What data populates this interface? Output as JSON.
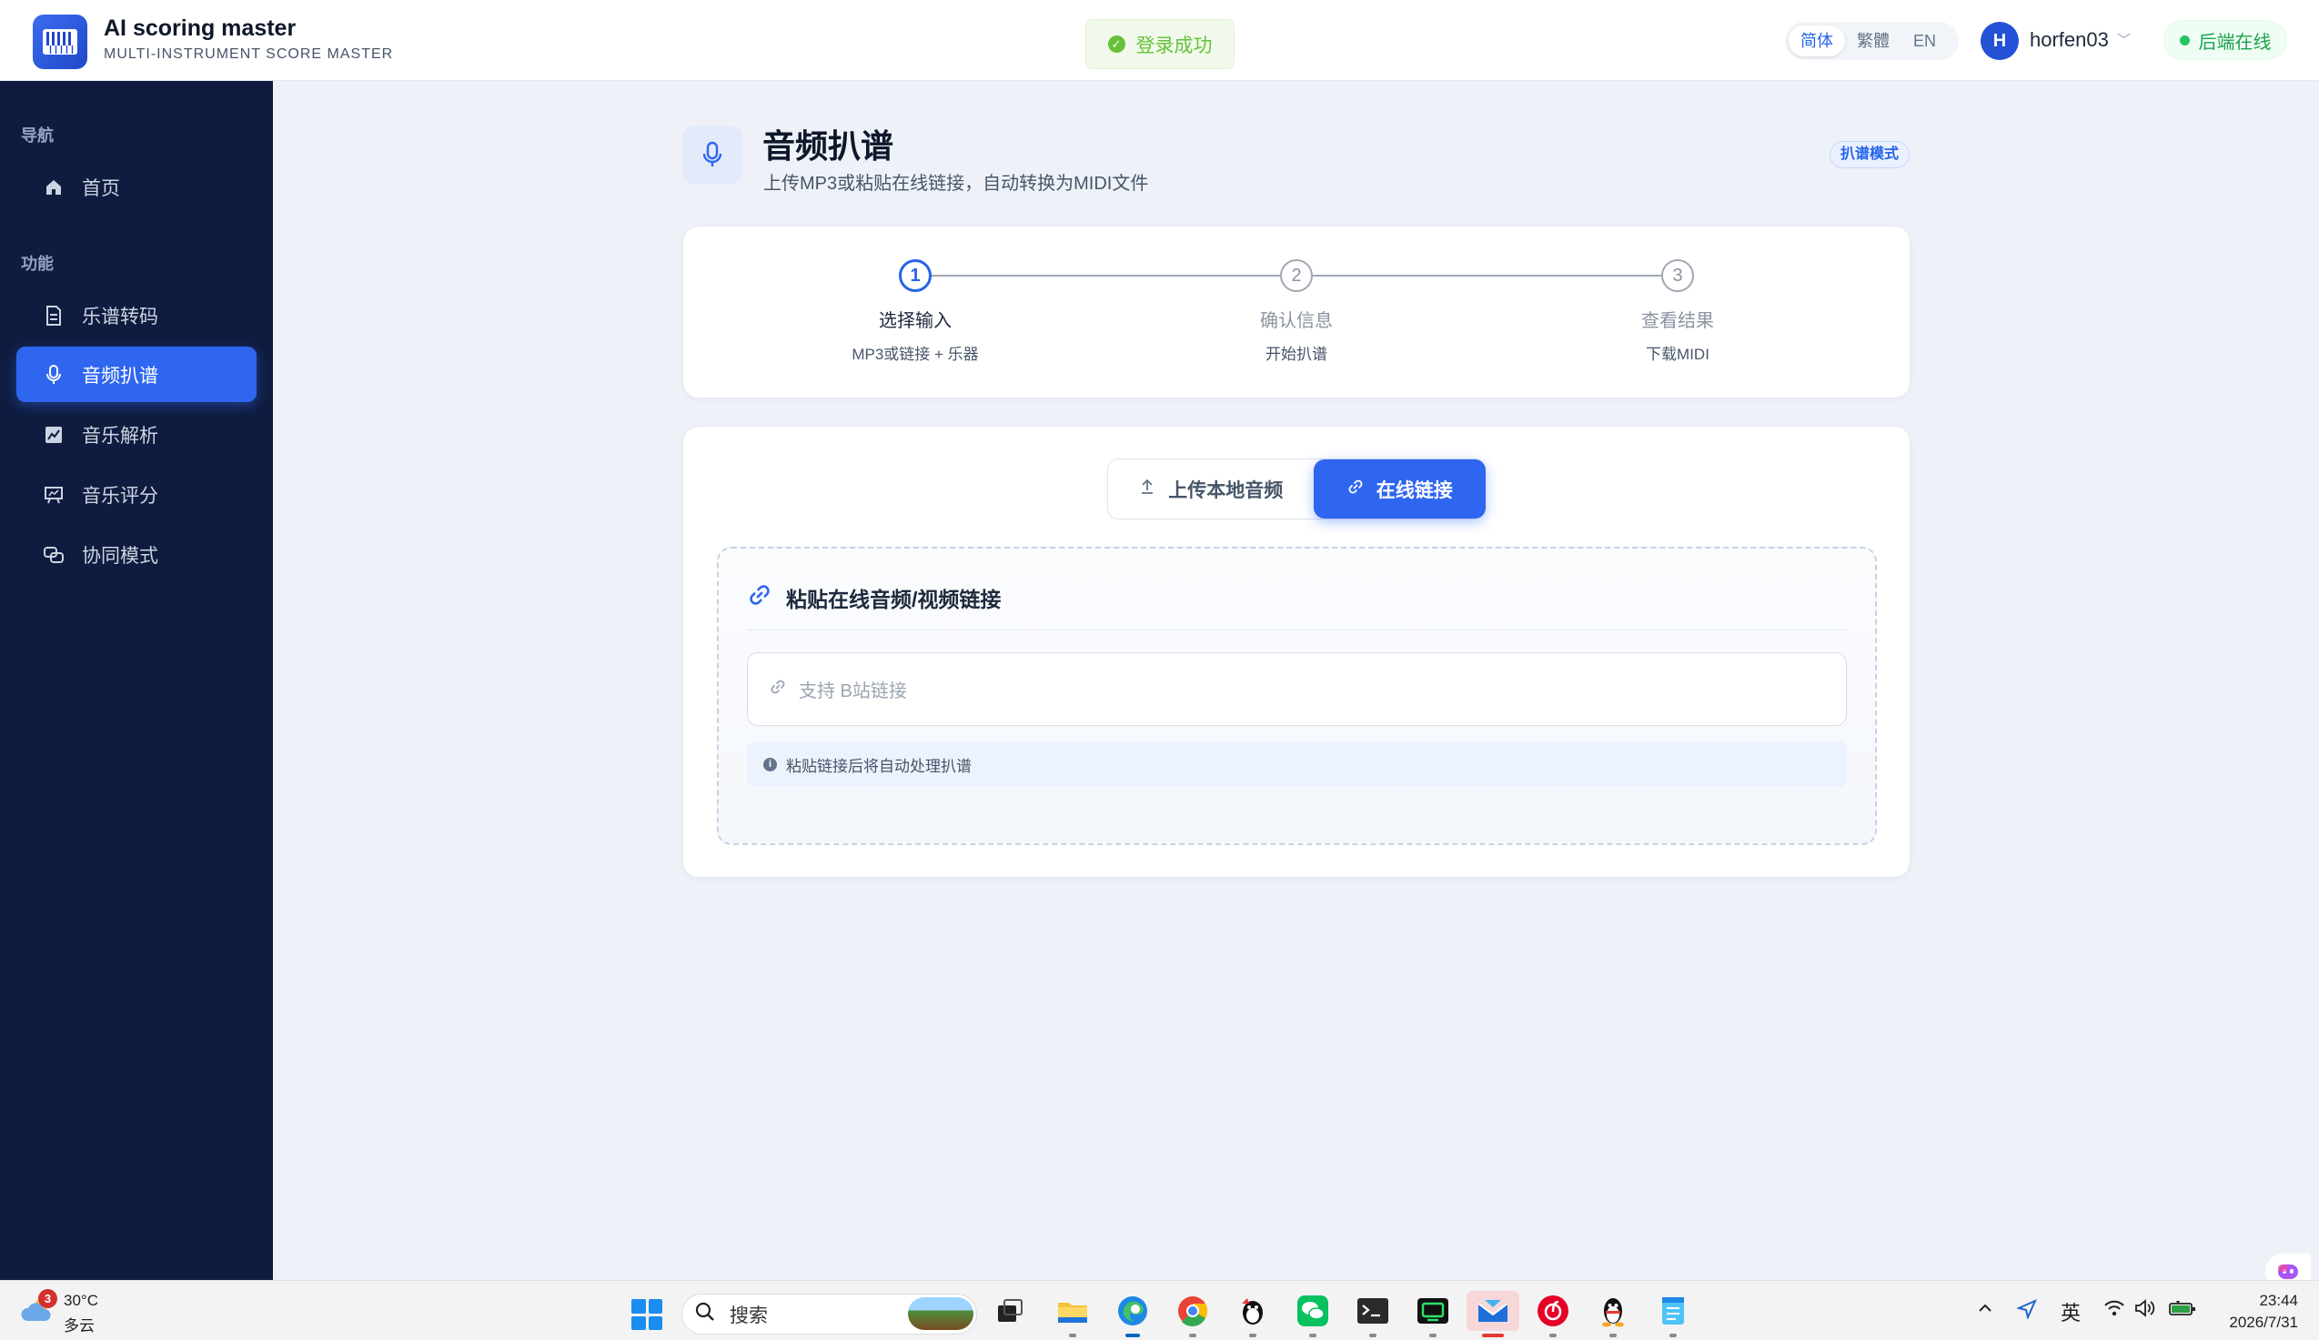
{
  "header": {
    "app_title": "AI scoring master",
    "app_subtitle": "MULTI-INSTRUMENT SCORE MASTER",
    "toast": "登录成功",
    "languages": [
      "简体",
      "繁體",
      "EN"
    ],
    "active_language": "简体",
    "avatar_initial": "H",
    "username": "horfen03",
    "status": "后端在线"
  },
  "sidebar": {
    "section_nav": "导航",
    "section_features": "功能",
    "items": [
      {
        "label": "首页",
        "icon": "home-icon"
      },
      {
        "label": "乐谱转码",
        "icon": "document-icon"
      },
      {
        "label": "音频扒谱",
        "icon": "microphone-icon",
        "active": true
      },
      {
        "label": "音乐解析",
        "icon": "chart-icon"
      },
      {
        "label": "音乐评分",
        "icon": "presentation-icon"
      },
      {
        "label": "协同模式",
        "icon": "collaboration-icon"
      }
    ]
  },
  "page": {
    "title": "音频扒谱",
    "subtitle": "上传MP3或粘贴在线链接，自动转换为MIDI文件",
    "mode_badge": "扒谱模式"
  },
  "steps": [
    {
      "number": "1",
      "label": "选择输入",
      "desc": "MP3或链接 + 乐器",
      "active": true
    },
    {
      "number": "2",
      "label": "确认信息",
      "desc": "开始扒谱",
      "active": false
    },
    {
      "number": "3",
      "label": "查看结果",
      "desc": "下载MIDI",
      "active": false
    }
  ],
  "tabs": {
    "upload": "上传本地音频",
    "link": "在线链接"
  },
  "link_panel": {
    "heading": "粘贴在线音频/视频链接",
    "input_placeholder": "支持 B站链接",
    "hint": "粘贴链接后将自动处理扒谱"
  },
  "taskbar": {
    "weather_badge": "3",
    "temperature": "30°C",
    "condition": "多云",
    "search_placeholder": "搜索",
    "ime": "英",
    "time": "23:44",
    "date": "2026/7/31"
  },
  "colors": {
    "accent": "#2f66f0",
    "sidebar_bg": "#0f1c3f",
    "success": "#67c23a",
    "online": "#16a34a"
  }
}
